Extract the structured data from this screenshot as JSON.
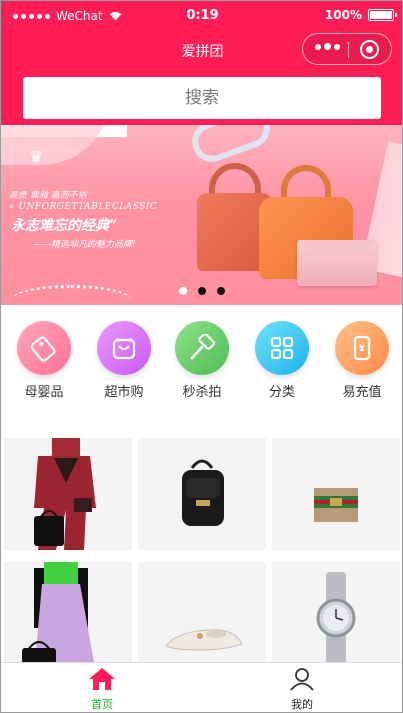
{
  "status_bar": {
    "carrier": "WeChat",
    "time": "0:19",
    "battery": "100%"
  },
  "navbar": {
    "title": "爱拼团"
  },
  "search": {
    "placeholder": "搜索"
  },
  "banner": {
    "line1": "高贵 典雅 高而不俗",
    "line2": "« UNFORGETTABLECLASSIC",
    "line3": "永志难忘的经典”",
    "line4": "——精选非凡的魅力品牌!",
    "slides": 3,
    "active_slide": 1
  },
  "categories": [
    {
      "label": "母婴品",
      "icon": "tag-icon",
      "color": "#ff7f9e"
    },
    {
      "label": "超市购",
      "icon": "shopping-bag-icon",
      "color": "#d66cf5"
    },
    {
      "label": "秒杀拍",
      "icon": "hammer-icon",
      "color": "#67d06c"
    },
    {
      "label": "分类",
      "icon": "grid-icon",
      "color": "#34c8ef"
    },
    {
      "label": "易充值",
      "icon": "phone-icon",
      "color": "#ff9a5a"
    }
  ],
  "products": [
    {
      "name": "burgundy-suit-model-image"
    },
    {
      "name": "black-backpack-image"
    },
    {
      "name": "web-stripe-wallet-image"
    },
    {
      "name": "green-top-lilac-skirt-model-image"
    },
    {
      "name": "white-ballet-flat-image"
    },
    {
      "name": "silver-watch-image"
    }
  ],
  "tabbar": {
    "home": "首页",
    "mine": "我的",
    "active_color": "#fe1e55"
  }
}
